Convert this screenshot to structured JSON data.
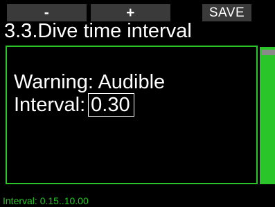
{
  "softkeys": {
    "minus_label": "-",
    "plus_label": "+",
    "save_label": "SAVE"
  },
  "title": "3.3.Dive time interval",
  "settings": {
    "warning_label": "Warning:",
    "warning_value": "Audible",
    "interval_label": "Interval:",
    "interval_value": "0.30"
  },
  "hint": "Interval: 0.15..10.00",
  "colors": {
    "accent": "#29c529",
    "softkey_bg": "#3a3a3a",
    "background": "#000000",
    "scroll_thumb": "#8a8a8a"
  },
  "scroll_position": 0
}
